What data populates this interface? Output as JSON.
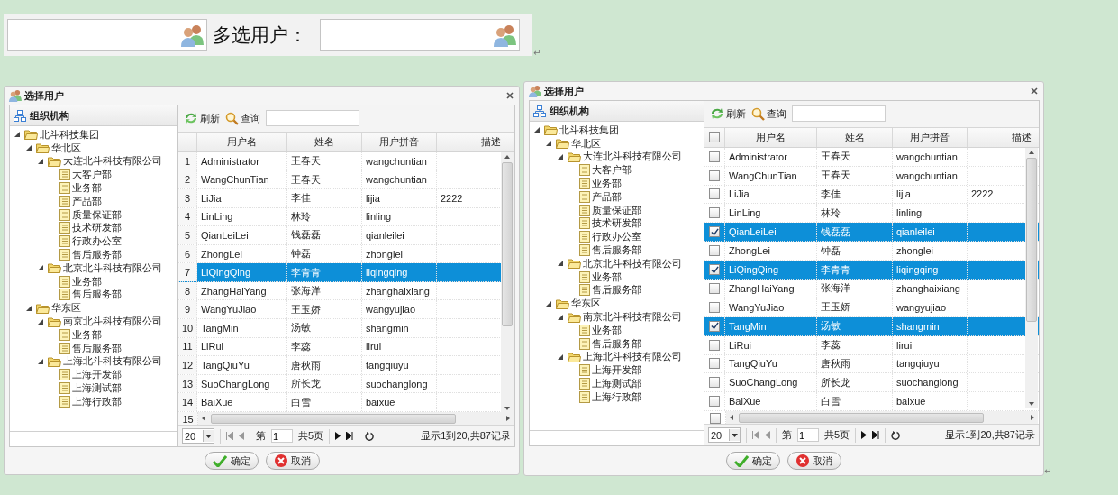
{
  "top_bar": {
    "label": "多选用户：",
    "end_mark": "↵"
  },
  "dialogs": [
    {
      "kind": "numbered",
      "title": "选择用户",
      "tree": {
        "header": "组织机构",
        "nodes": [
          {
            "label": "北斗科技集团",
            "expanded": true,
            "children": [
              {
                "label": "华北区",
                "expanded": true,
                "children": [
                  {
                    "label": "大连北斗科技有限公司",
                    "expanded": true,
                    "children": [
                      {
                        "label": "大客户部"
                      },
                      {
                        "label": "业务部"
                      },
                      {
                        "label": "产品部"
                      },
                      {
                        "label": "质量保证部"
                      },
                      {
                        "label": "技术研发部"
                      },
                      {
                        "label": "行政办公室"
                      },
                      {
                        "label": "售后服务部"
                      }
                    ]
                  },
                  {
                    "label": "北京北斗科技有限公司",
                    "expanded": true,
                    "children": [
                      {
                        "label": "业务部"
                      },
                      {
                        "label": "售后服务部"
                      }
                    ]
                  }
                ]
              },
              {
                "label": "华东区",
                "expanded": true,
                "children": [
                  {
                    "label": "南京北斗科技有限公司",
                    "expanded": true,
                    "children": [
                      {
                        "label": "业务部"
                      },
                      {
                        "label": "售后服务部"
                      }
                    ]
                  },
                  {
                    "label": "上海北斗科技有限公司",
                    "expanded": true,
                    "children": [
                      {
                        "label": "上海开发部"
                      },
                      {
                        "label": "上海测试部"
                      },
                      {
                        "label": "上海行政部"
                      }
                    ]
                  }
                ]
              }
            ]
          }
        ]
      },
      "toolbar": {
        "refresh": "刷新",
        "query": "查询"
      },
      "grid": {
        "columns": [
          "用户名",
          "姓名",
          "用户拼音",
          "描述"
        ],
        "rows": [
          {
            "number": "1",
            "cells": [
              "Administrator",
              "王春天",
              "wangchuntian"
            ],
            "selected": false
          },
          {
            "number": "2",
            "cells": [
              "WangChunTian",
              "王春天",
              "wangchuntian"
            ],
            "selected": false
          },
          {
            "number": "3",
            "cells": [
              "LiJia",
              "李佳",
              "lijia",
              "2222"
            ],
            "selected": false
          },
          {
            "number": "4",
            "cells": [
              "LinLing",
              "林玲",
              "linling"
            ],
            "selected": false
          },
          {
            "number": "5",
            "cells": [
              "QianLeiLei",
              "钱磊磊",
              "qianleilei"
            ],
            "selected": false
          },
          {
            "number": "6",
            "cells": [
              "ZhongLei",
              "钟磊",
              "zhonglei"
            ],
            "selected": false
          },
          {
            "number": "7",
            "cells": [
              "LiQingQing",
              "李青青",
              "liqingqing"
            ],
            "selected": true
          },
          {
            "number": "8",
            "cells": [
              "ZhangHaiYang",
              "张海洋",
              "zhanghaixiang"
            ],
            "selected": false
          },
          {
            "number": "9",
            "cells": [
              "WangYuJiao",
              "王玉娇",
              "wangyujiao"
            ],
            "selected": false
          },
          {
            "number": "10",
            "cells": [
              "TangMin",
              "汤敏",
              "shangmin"
            ],
            "selected": false
          },
          {
            "number": "11",
            "cells": [
              "LiRui",
              "李蕊",
              "lirui"
            ],
            "selected": false
          },
          {
            "number": "12",
            "cells": [
              "TangQiuYu",
              "唐秋雨",
              "tangqiuyu"
            ],
            "selected": false
          },
          {
            "number": "13",
            "cells": [
              "SuoChangLong",
              "所长龙",
              "suochanglong"
            ],
            "selected": false
          },
          {
            "number": "14",
            "cells": [
              "BaiXue",
              "白雪",
              "baixue"
            ],
            "selected": false
          },
          {
            "number": "15"
          }
        ]
      },
      "pager": {
        "page_size": "20",
        "page_prefix": "第",
        "page": "1",
        "total_pages": "共5页",
        "summary": "显示1到20,共87记录"
      },
      "buttons": [
        {
          "kind": "ok",
          "label": "确定"
        },
        {
          "kind": "cancel",
          "label": "取消"
        }
      ]
    },
    {
      "kind": "checkbox",
      "title": "选择用户",
      "tree": {
        "header": "组织机构",
        "nodes": [
          {
            "label": "北斗科技集团",
            "expanded": true,
            "children": [
              {
                "label": "华北区",
                "expanded": true,
                "children": [
                  {
                    "label": "大连北斗科技有限公司",
                    "expanded": true,
                    "children": [
                      {
                        "label": "大客户部"
                      },
                      {
                        "label": "业务部"
                      },
                      {
                        "label": "产品部"
                      },
                      {
                        "label": "质量保证部"
                      },
                      {
                        "label": "技术研发部"
                      },
                      {
                        "label": "行政办公室"
                      },
                      {
                        "label": "售后服务部"
                      }
                    ]
                  },
                  {
                    "label": "北京北斗科技有限公司",
                    "expanded": true,
                    "children": [
                      {
                        "label": "业务部"
                      },
                      {
                        "label": "售后服务部"
                      }
                    ]
                  }
                ]
              },
              {
                "label": "华东区",
                "expanded": true,
                "children": [
                  {
                    "label": "南京北斗科技有限公司",
                    "expanded": true,
                    "children": [
                      {
                        "label": "业务部"
                      },
                      {
                        "label": "售后服务部"
                      }
                    ]
                  },
                  {
                    "label": "上海北斗科技有限公司",
                    "expanded": true,
                    "children": [
                      {
                        "label": "上海开发部"
                      },
                      {
                        "label": "上海测试部"
                      },
                      {
                        "label": "上海行政部"
                      }
                    ]
                  }
                ]
              }
            ]
          }
        ]
      },
      "toolbar": {
        "refresh": "刷新",
        "query": "查询"
      },
      "grid": {
        "all_checked": false,
        "columns": [
          "用户名",
          "姓名",
          "用户拼音",
          "描述"
        ],
        "rows": [
          {
            "checked": false,
            "cells": [
              "Administrator",
              "王春天",
              "wangchuntian"
            ],
            "selected": false
          },
          {
            "checked": false,
            "cells": [
              "WangChunTian",
              "王春天",
              "wangchuntian"
            ],
            "selected": false
          },
          {
            "checked": false,
            "cells": [
              "LiJia",
              "李佳",
              "lijia",
              "2222"
            ],
            "selected": false
          },
          {
            "checked": false,
            "cells": [
              "LinLing",
              "林玲",
              "linling"
            ],
            "selected": false
          },
          {
            "checked": true,
            "cells": [
              "QianLeiLei",
              "钱磊磊",
              "qianleilei"
            ],
            "selected": true
          },
          {
            "checked": false,
            "cells": [
              "ZhongLei",
              "钟磊",
              "zhonglei"
            ],
            "selected": false
          },
          {
            "checked": true,
            "cells": [
              "LiQingQing",
              "李青青",
              "liqingqing"
            ],
            "selected": true
          },
          {
            "checked": false,
            "cells": [
              "ZhangHaiYang",
              "张海洋",
              "zhanghaixiang"
            ],
            "selected": false
          },
          {
            "checked": false,
            "cells": [
              "WangYuJiao",
              "王玉娇",
              "wangyujiao"
            ],
            "selected": false
          },
          {
            "checked": true,
            "cells": [
              "TangMin",
              "汤敏",
              "shangmin"
            ],
            "selected": true
          },
          {
            "checked": false,
            "cells": [
              "LiRui",
              "李蕊",
              "lirui"
            ],
            "selected": false
          },
          {
            "checked": false,
            "cells": [
              "TangQiuYu",
              "唐秋雨",
              "tangqiuyu"
            ],
            "selected": false
          },
          {
            "checked": false,
            "cells": [
              "SuoChangLong",
              "所长龙",
              "suochanglong"
            ],
            "selected": false
          },
          {
            "checked": false,
            "cells": [
              "BaiXue",
              "白雪",
              "baixue"
            ],
            "selected": false
          },
          {
            "checked": false
          }
        ]
      },
      "pager": {
        "page_size": "20",
        "page_prefix": "第",
        "page": "1",
        "total_pages": "共5页",
        "summary": "显示1到20,共87记录"
      },
      "buttons": [
        {
          "kind": "ok",
          "label": "确定"
        },
        {
          "kind": "cancel",
          "label": "取消"
        }
      ],
      "end_mark": "↵"
    }
  ]
}
